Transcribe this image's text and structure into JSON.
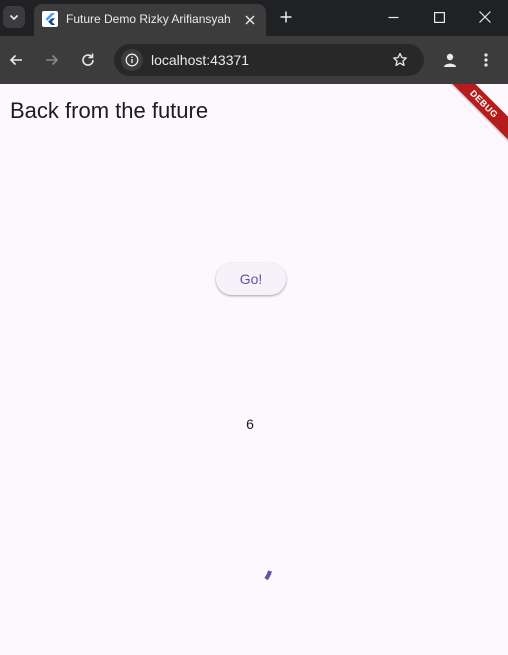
{
  "browser": {
    "tab": {
      "title": "Future Demo Rizky Arifiansyah",
      "favicon": "flutter-logo-icon"
    },
    "address_bar": {
      "url": "localhost:43371"
    },
    "icons": {
      "tab_search": "chevron-down-icon",
      "close_tab": "close-icon",
      "new_tab": "plus-icon",
      "minimize": "minimize-icon",
      "maximize": "maximize-icon",
      "close_window": "close-icon",
      "back": "back-arrow-icon",
      "forward": "forward-arrow-icon",
      "reload": "reload-icon",
      "site_info": "info-icon",
      "bookmark": "star-icon",
      "profile": "profile-icon",
      "menu": "kebab-menu-icon"
    }
  },
  "app": {
    "title": "Back from the future",
    "debug_banner": "DEBUG",
    "go_button_label": "Go!",
    "result": "6",
    "loading": true
  },
  "colors": {
    "page_background": "#fdf7fe",
    "primary": "#6750a4",
    "debug_banner": "#b71c1c",
    "browser_frame": "#202124",
    "browser_toolbar": "#3c3c3c"
  }
}
